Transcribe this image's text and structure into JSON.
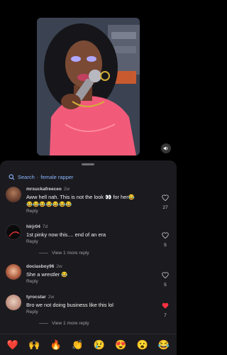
{
  "search": {
    "label": "Search",
    "separator": "·",
    "query": "female rapper"
  },
  "comments": [
    {
      "username": "mrsuckafreeceo",
      "time": "2w",
      "text": "Aww hell nah. This is not the look 👀 for her😂",
      "text_line2": "😂😂😂😂😂😂😂",
      "reply": "Reply",
      "likes": "27",
      "liked": false
    },
    {
      "username": "hlrjr04",
      "time": "7d",
      "text": "1st pinky now this.... end of an era",
      "reply": "Reply",
      "likes": "5",
      "liked": false,
      "more_replies": "View 1 more reply"
    },
    {
      "username": "dociasboy96",
      "time": "2w",
      "text": "She a wrestler 😂",
      "reply": "Reply",
      "likes": "5",
      "liked": false
    },
    {
      "username": "tyrocstar",
      "time": "2w",
      "text": "Bro we not doing business like this lol",
      "reply": "Reply",
      "likes": "7",
      "liked": true,
      "more_replies": "View 1 more reply"
    }
  ],
  "emoji_bar": [
    "❤️",
    "🙌",
    "🔥",
    "👏",
    "😢",
    "😍",
    "😮",
    "😂"
  ],
  "colors": {
    "accent_link": "#8ab4ff",
    "like_active": "#ff3040",
    "sheet_bg": "#1b1b1f"
  }
}
